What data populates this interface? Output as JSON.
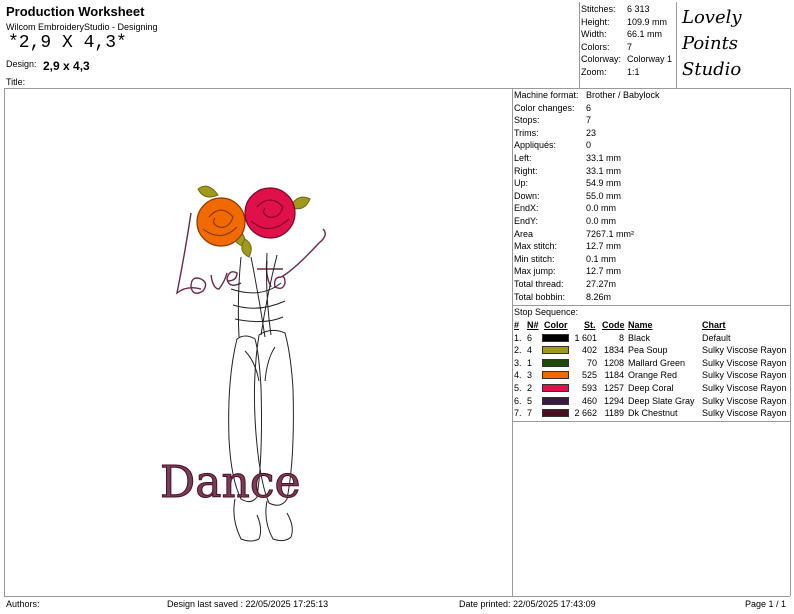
{
  "header": {
    "title": "Production Worksheet",
    "app": "Wilcom EmbroideryStudio - Designing",
    "big_name": "*2,9 X 4,3*",
    "design_label": "Design:",
    "design_value": "2,9 x 4,3",
    "title_label": "Title:"
  },
  "summary": [
    {
      "label": "Stitches:",
      "value": "6 313"
    },
    {
      "label": "Height:",
      "value": "109.9 mm"
    },
    {
      "label": "Width:",
      "value": "66.1 mm"
    },
    {
      "label": "Colors:",
      "value": "7"
    },
    {
      "label": "Colorway:",
      "value": "Colorway 1"
    },
    {
      "label": "Zoom:",
      "value": "1:1"
    }
  ],
  "logo": {
    "line1": "Lovely",
    "line2": "Points",
    "line3": "Studio"
  },
  "details": [
    {
      "label": "Machine format:",
      "value": "Brother / Babylock"
    },
    {
      "label": "Color changes:",
      "value": "6"
    },
    {
      "label": "Stops:",
      "value": "7"
    },
    {
      "label": "Trims:",
      "value": "23"
    },
    {
      "label": "Appliqués:",
      "value": "0"
    },
    {
      "label": "Left:",
      "value": "33.1 mm"
    },
    {
      "label": "Right:",
      "value": "33.1 mm"
    },
    {
      "label": "Up:",
      "value": "54.9 mm"
    },
    {
      "label": "Down:",
      "value": "55.0 mm"
    },
    {
      "label": "EndX:",
      "value": "0.0 mm"
    },
    {
      "label": "EndY:",
      "value": "0.0 mm"
    },
    {
      "label": "Area",
      "value": "7267.1 mm²"
    },
    {
      "label": "Max stitch:",
      "value": "12.7 mm"
    },
    {
      "label": "Min stitch:",
      "value": "0.1 mm"
    },
    {
      "label": "Max jump:",
      "value": "12.7 mm"
    },
    {
      "label": "Total thread:",
      "value": "27.27m"
    },
    {
      "label": "Total bobbin:",
      "value": "8.26m"
    }
  ],
  "stop_sequence": {
    "title": "Stop Sequence:",
    "headers": {
      "idx": "#",
      "n": "N#",
      "color": "Color",
      "st": "St.",
      "code": "Code",
      "name": "Name",
      "chart": "Chart"
    },
    "rows": [
      {
        "idx": "1.",
        "n": "6",
        "hex": "#000000",
        "st": "1 601",
        "code": "8",
        "name": "Black",
        "chart": "Default"
      },
      {
        "idx": "2.",
        "n": "4",
        "hex": "#a09a1c",
        "st": "402",
        "code": "1834",
        "name": "Pea Soup",
        "chart": "Sulky Viscose Rayon"
      },
      {
        "idx": "3.",
        "n": "1",
        "hex": "#1e4a0a",
        "st": "70",
        "code": "1208",
        "name": "Mallard Green",
        "chart": "Sulky Viscose Rayon"
      },
      {
        "idx": "4.",
        "n": "3",
        "hex": "#f06a00",
        "st": "525",
        "code": "1184",
        "name": "Orange Red",
        "chart": "Sulky Viscose Rayon"
      },
      {
        "idx": "5.",
        "n": "2",
        "hex": "#e0104a",
        "st": "593",
        "code": "1257",
        "name": "Deep Coral",
        "chart": "Sulky Viscose Rayon"
      },
      {
        "idx": "6.",
        "n": "5",
        "hex": "#3a1a40",
        "st": "460",
        "code": "1294",
        "name": "Deep Slate Gray",
        "chart": "Sulky Viscose Rayon"
      },
      {
        "idx": "7.",
        "n": "7",
        "hex": "#4a0f22",
        "st": "2 662",
        "code": "1189",
        "name": "Dk Chestnut",
        "chart": "Sulky Viscose Rayon"
      }
    ]
  },
  "design_text": {
    "script": "Love to",
    "main": "Dance"
  },
  "footer": {
    "authors": "Authors:",
    "saved": "Design last saved : 22/05/2025 17:25:13",
    "printed": "Date printed: 22/05/2025 17:43:09",
    "page": "Page 1 / 1"
  }
}
